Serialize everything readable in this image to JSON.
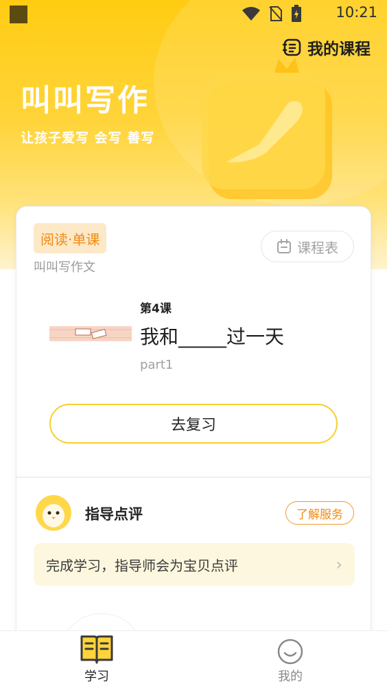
{
  "status_bar": {
    "time": "10:21",
    "icons": [
      "app-notification-square-icon",
      "wifi-icon",
      "no-sim-icon",
      "battery-charging-icon"
    ]
  },
  "header": {
    "my_courses_label": "我的课程",
    "brand_title": "叫叫写作",
    "slogan": "让孩子爱写  会写  善写"
  },
  "course_card": {
    "badge": "阅读·单课",
    "subject": "叫叫写作文",
    "schedule_label": "课程表",
    "lesson_number": "第4课",
    "lesson_title": "我和_____过一天",
    "lesson_part": "part1",
    "review_button": "去复习"
  },
  "tutor_section": {
    "title": "指导点评",
    "service_button": "了解服务",
    "tip": "完成学习，指导师会为宝贝点评",
    "tip_chevron": "›"
  },
  "tab_bar": {
    "tabs": [
      {
        "label": "学习",
        "icon": "book-icon",
        "active": true
      },
      {
        "label": "我的",
        "icon": "smiley-icon",
        "active": false
      }
    ]
  },
  "colors": {
    "brand_yellow": "#ffcc12",
    "accent_orange": "#ef8a14",
    "badge_bg": "#fde9c8",
    "tip_bg": "#fdf7df"
  }
}
